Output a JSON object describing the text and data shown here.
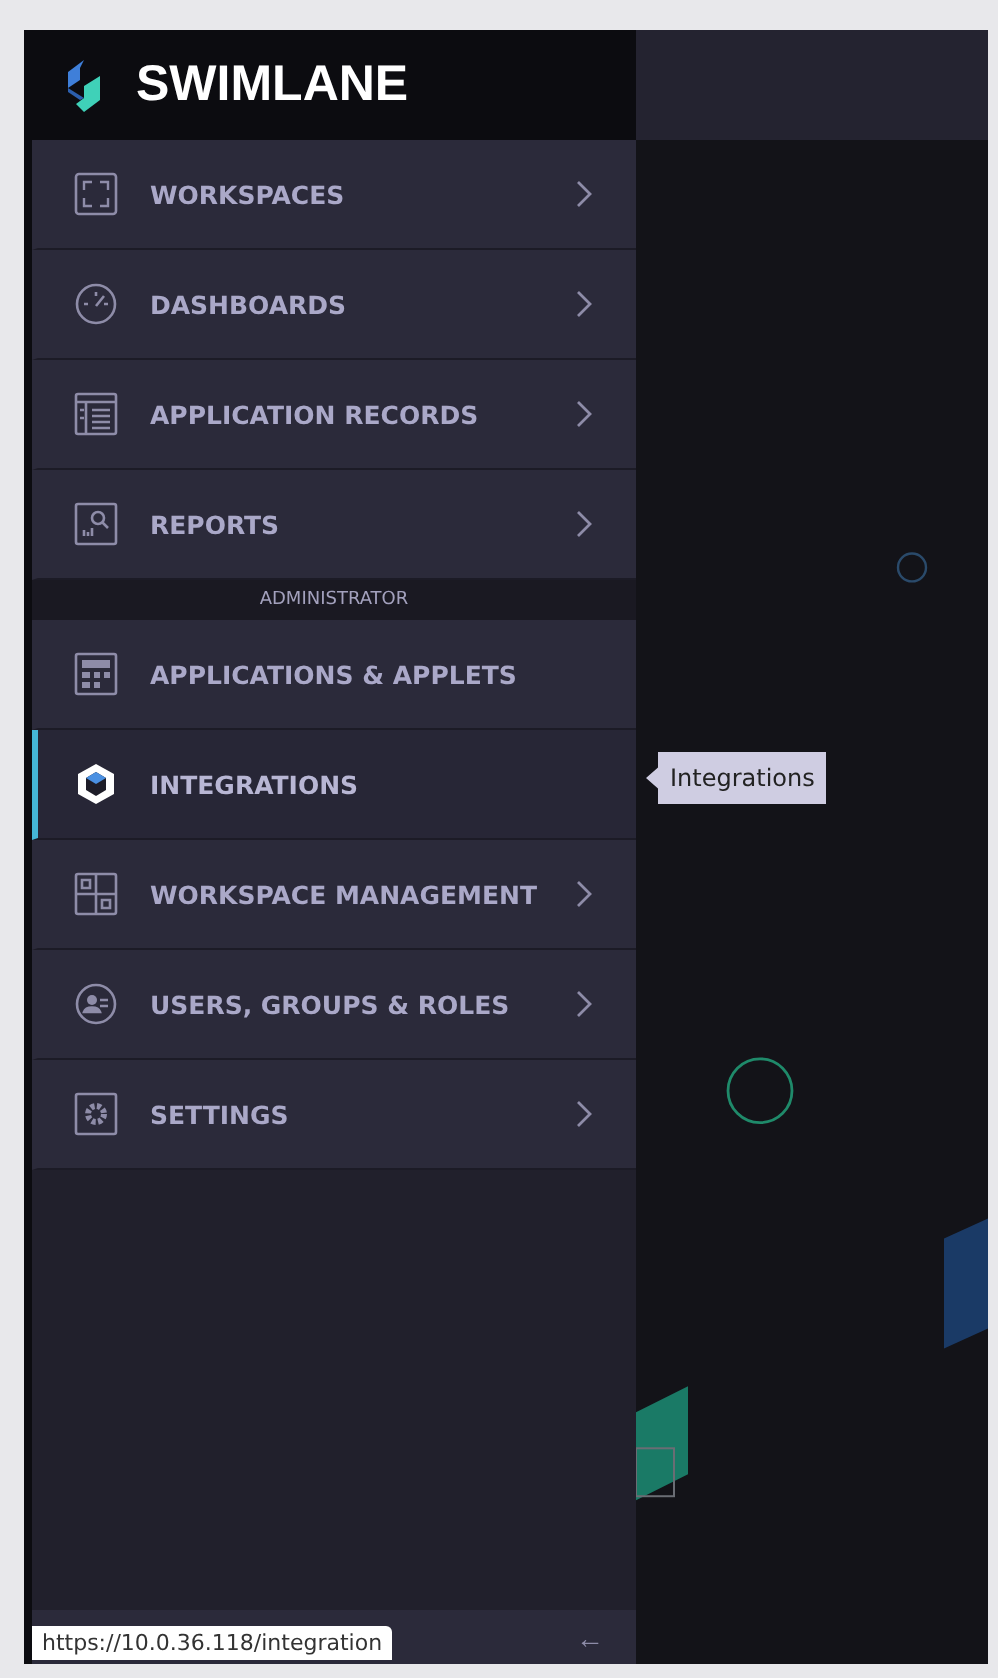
{
  "brand": {
    "name": "SWIMLANE"
  },
  "nav": {
    "items": [
      {
        "label": "WORKSPACES",
        "expandable": true,
        "selected": false
      },
      {
        "label": "DASHBOARDS",
        "expandable": true,
        "selected": false
      },
      {
        "label": "APPLICATION RECORDS",
        "expandable": true,
        "selected": false
      },
      {
        "label": "REPORTS",
        "expandable": true,
        "selected": false
      }
    ],
    "section_title": "ADMINISTRATOR",
    "admin_items": [
      {
        "label": "APPLICATIONS & APPLETS",
        "expandable": false,
        "selected": false
      },
      {
        "label": "INTEGRATIONS",
        "expandable": false,
        "selected": true
      },
      {
        "label": "WORKSPACE MANAGEMENT",
        "expandable": true,
        "selected": false
      },
      {
        "label": "USERS, GROUPS & ROLES",
        "expandable": true,
        "selected": false
      },
      {
        "label": "SETTINGS",
        "expandable": true,
        "selected": false
      }
    ]
  },
  "tooltip": {
    "text": "Integrations"
  },
  "footer": {
    "collapse": "←"
  },
  "status_url": "https://10.0.36.118/integration"
}
